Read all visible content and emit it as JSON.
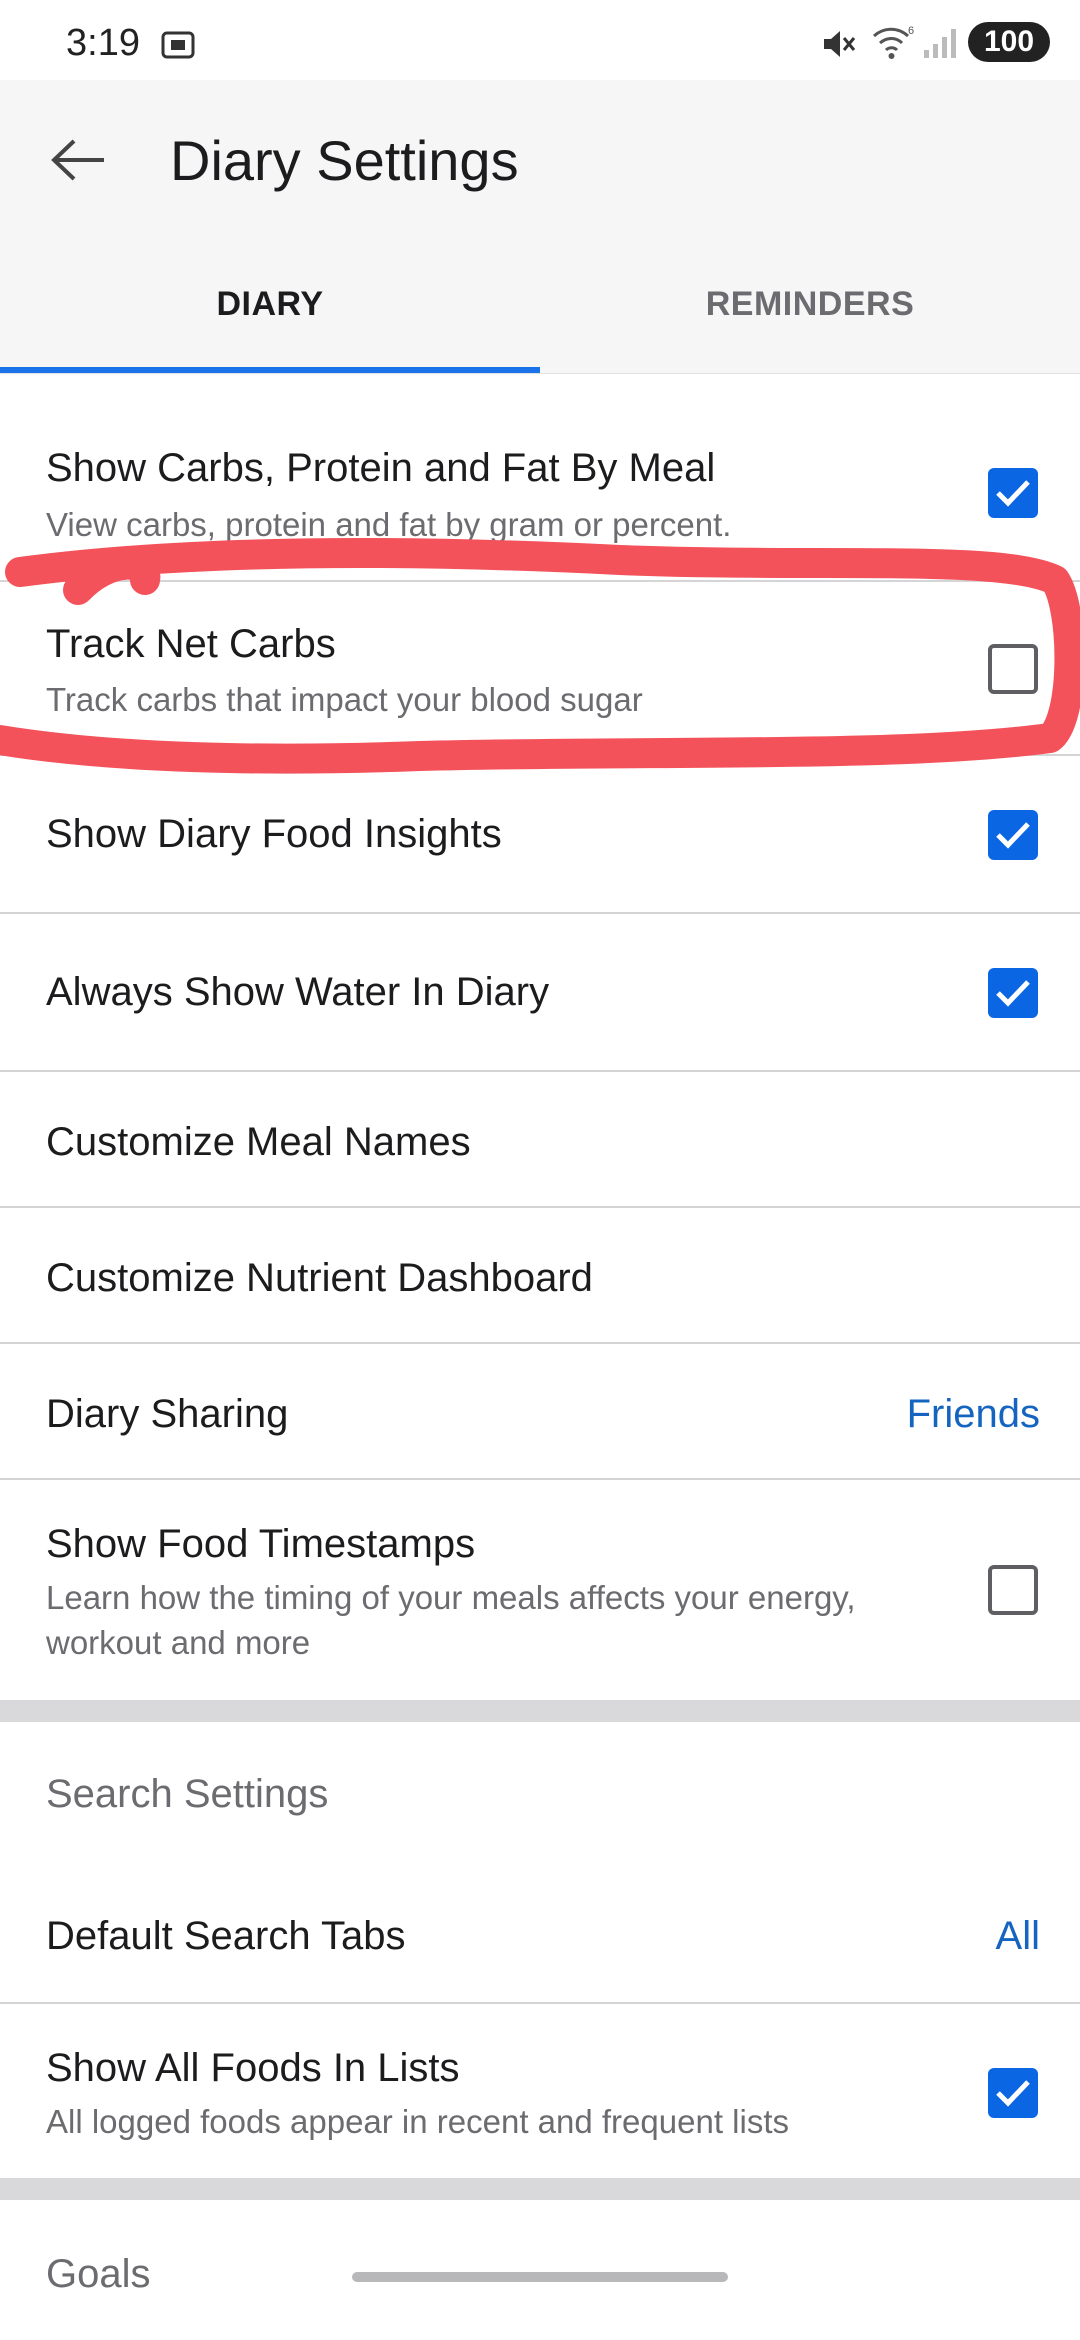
{
  "status": {
    "time": "3:19",
    "battery": "100"
  },
  "header": {
    "title": "Diary Settings"
  },
  "tabs": [
    {
      "label": "DIARY",
      "active": true
    },
    {
      "label": "REMINDERS",
      "active": false
    }
  ],
  "rows": [
    {
      "title": "Show Carbs, Protein and Fat By Meal",
      "subtitle": "View carbs, protein and fat by gram or percent.",
      "checked": true
    },
    {
      "title": "Track Net Carbs",
      "subtitle": "Track carbs that impact your blood sugar",
      "checked": false
    },
    {
      "title": "Show Diary Food Insights",
      "checked": true
    },
    {
      "title": "Always Show Water In Diary",
      "checked": true
    },
    {
      "title": "Customize Meal Names"
    },
    {
      "title": "Customize Nutrient Dashboard"
    },
    {
      "title": "Diary Sharing",
      "value": "Friends"
    },
    {
      "title": "Show Food Timestamps",
      "subtitle": "Learn how the timing of your meals affects your energy, workout and more",
      "checked": false
    }
  ],
  "search_settings": {
    "heading": "Search Settings",
    "rows": [
      {
        "title": "Default Search Tabs",
        "value": "All"
      },
      {
        "title": "Show All Foods In Lists",
        "subtitle": "All logged foods appear in recent and frequent lists",
        "checked": true
      }
    ]
  },
  "goals": {
    "heading": "Goals"
  },
  "colors": {
    "accent": "#0b66e4",
    "link": "#1565c0",
    "annotation": "#f4525a"
  }
}
